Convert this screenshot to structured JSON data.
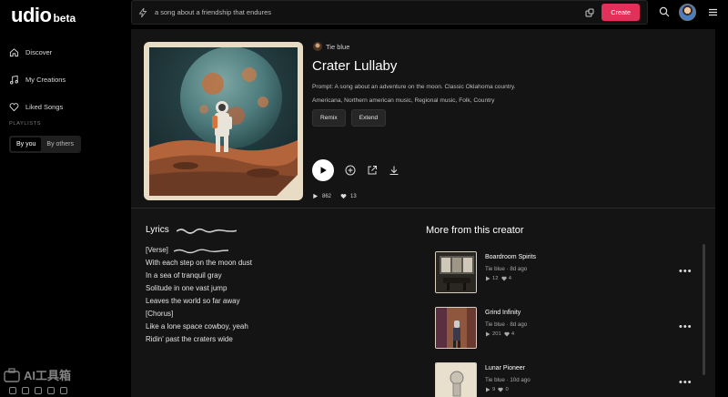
{
  "app": {
    "logo": "udio",
    "logo_badge": "beta"
  },
  "sidebar": {
    "items": [
      {
        "label": "Discover",
        "icon": "home-icon"
      },
      {
        "label": "My Creations",
        "icon": "music-note-icon"
      },
      {
        "label": "Liked Songs",
        "icon": "heart-icon"
      }
    ],
    "playlists_heading": "PLAYLISTS",
    "tabs": [
      {
        "label": "By you",
        "active": true
      },
      {
        "label": "By others",
        "active": false
      }
    ]
  },
  "search": {
    "value": "a song about a friendship that endures",
    "create_label": "Create"
  },
  "song": {
    "artist": "Tie blue",
    "title": "Crater Lullaby",
    "prompt": "Prompt: A song about an adventure on the moon. Classic Oklahoma country.",
    "tags": "Americana, Northern american music, Regional music, Folk, Country",
    "remix_label": "Remix",
    "extend_label": "Extend",
    "plays": "862",
    "likes": "13"
  },
  "lyrics": {
    "heading": "Lyrics",
    "lines": [
      "[Verse]",
      "With each step on the moon dust",
      "In a sea of tranquil gray",
      "Solitude in one vast jump",
      "Leaves the world so far away",
      "[Chorus]",
      "Like a lone space cowboy, yeah",
      "Ridin' past the craters wide"
    ]
  },
  "more": {
    "heading": "More from this creator",
    "tracks": [
      {
        "title": "Boardroom Spirits",
        "artist": "Tie blue",
        "age": "8d ago",
        "plays": "12",
        "likes": "4"
      },
      {
        "title": "Grind Infinity",
        "artist": "Tie blue",
        "age": "8d ago",
        "plays": "201",
        "likes": "4"
      },
      {
        "title": "Lunar Pioneer",
        "artist": "Tie blue",
        "age": "10d ago",
        "plays": "9",
        "likes": "0"
      }
    ],
    "menu_glyph": "•••",
    "separator": "·"
  },
  "watermark": {
    "text": "AI工具箱"
  },
  "colors": {
    "accent": "#e2305a",
    "background": "#000000",
    "panel": "#141414"
  }
}
